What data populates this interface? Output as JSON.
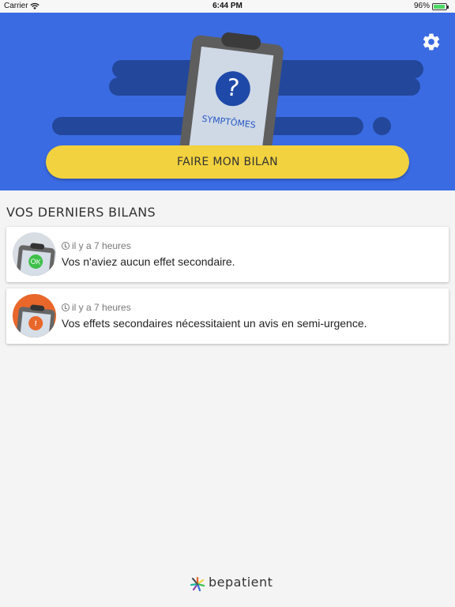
{
  "status_bar": {
    "carrier": "Carrier",
    "time": "6:44 PM",
    "battery_percent": "96%",
    "battery_level": 0.96
  },
  "hero": {
    "clipboard_label": "SYMPTÔMES",
    "clipboard_symbol": "?",
    "cta_label": "FAIRE MON BILAN",
    "settings_icon": "gear-icon",
    "colors": {
      "background": "#3a6be2",
      "cta": "#f2d23e"
    }
  },
  "section": {
    "title": "VOS DERNIERS BILANS"
  },
  "bilans": [
    {
      "time": "il y a 7 heures",
      "text": "Vos n'aviez aucun effet secondaire.",
      "badge": "OK",
      "status_color": "#3ec04b"
    },
    {
      "time": "il y a 7 heures",
      "text": "Vos effets secondaires nécessitaient un avis en semi-urgence.",
      "badge": "!",
      "status_color": "#e9672a"
    }
  ],
  "footer": {
    "brand": "bepatient"
  }
}
